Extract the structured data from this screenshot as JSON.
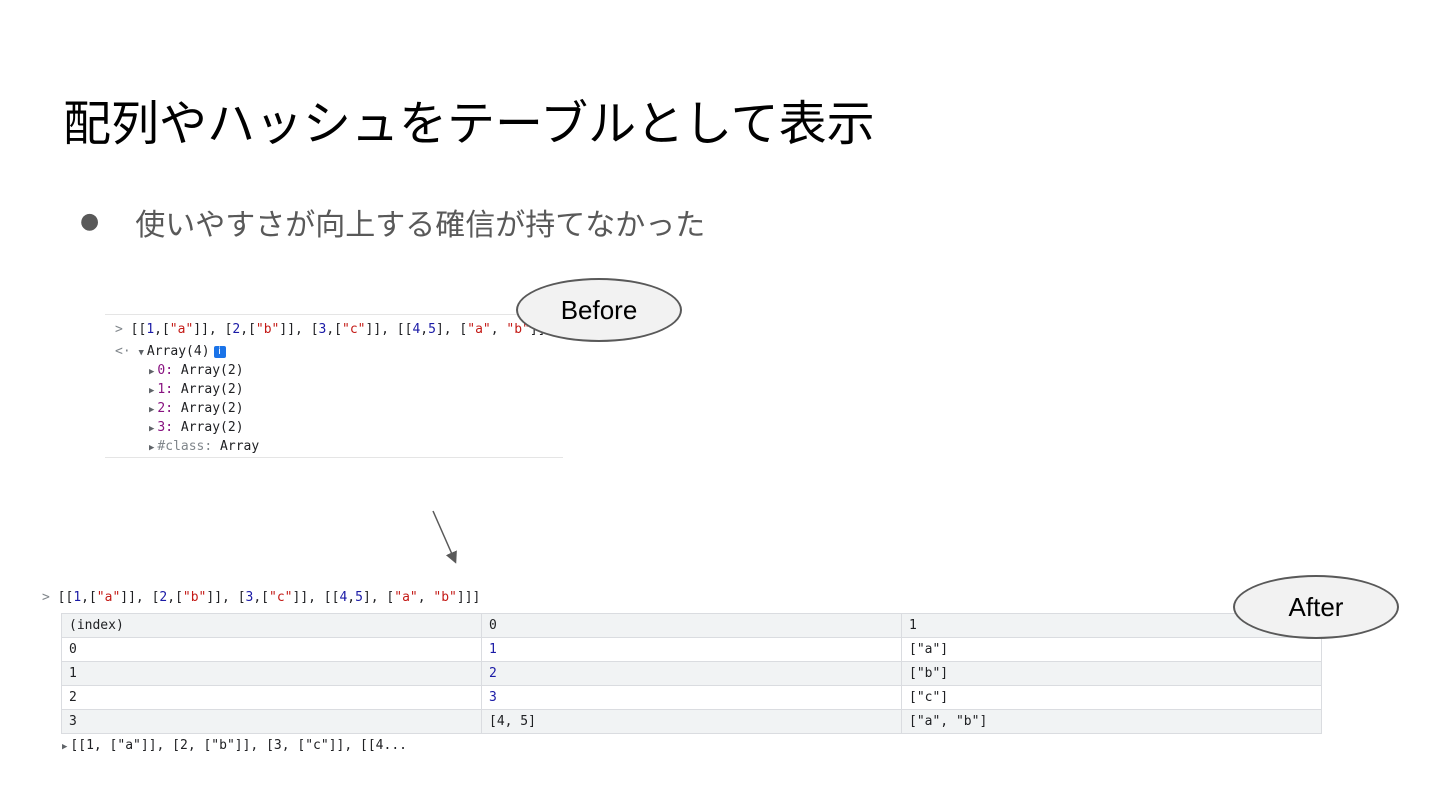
{
  "slide": {
    "title": "配列やハッシュをテーブルとして表示",
    "bullet": "使いやすさが向上する確信が持てなかった"
  },
  "before": {
    "label": "Before",
    "input_prompt": ">",
    "result_prompt": "<·",
    "array_label": "Array(4)",
    "info_badge": "i",
    "children": [
      {
        "key": "0",
        "value": "Array(2)"
      },
      {
        "key": "1",
        "value": "Array(2)"
      },
      {
        "key": "2",
        "value": "Array(2)"
      },
      {
        "key": "3",
        "value": "Array(2)"
      },
      {
        "key": "#class",
        "value": "Array"
      }
    ]
  },
  "after": {
    "label": "After",
    "input_prompt": ">",
    "table": {
      "headers": [
        "(index)",
        "0",
        "1"
      ],
      "rows": [
        [
          "0",
          "1",
          "[\"a\"]"
        ],
        [
          "1",
          "2",
          "[\"b\"]"
        ],
        [
          "2",
          "3",
          "[\"c\"]"
        ],
        [
          "3",
          "[4, 5]",
          "[\"a\", \"b\"]"
        ]
      ]
    },
    "summary": "[[1, [\"a\"]], [2, [\"b\"]], [3, [\"c\"]], [[4..."
  },
  "colors": {
    "number": "#1a1aa6",
    "string": "#c41a16",
    "property_key": "#881280",
    "info_badge": "#1a73e8",
    "table_header_bg": "#f1f3f4"
  }
}
